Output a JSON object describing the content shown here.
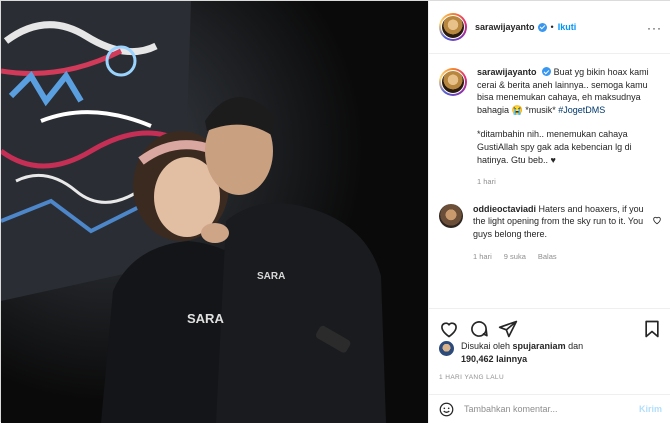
{
  "header": {
    "username": "sarawijayanto",
    "separator": "•",
    "follow_label": "Ikuti",
    "more_label": "···"
  },
  "caption": {
    "username": "sarawijayanto",
    "text_part1": "Buat yg bikin hoax kami cerai & berita aneh lainnya.. semoga kamu bisa menemukan cahaya, eh maksudnya bahagia 😭 *musik* ",
    "hashtag": "#JogetDMS",
    "text_part2": "*ditambahin nih.. menemukan cahaya GustiAllah spy gak ada kebencian lg di hatinya. Gtu beb.. ♥",
    "time": "1 hari"
  },
  "comment": {
    "username": "oddieoctaviadi",
    "text": "Haters and hoaxers, if you the light opening from the sky run to it. You guys belong there.",
    "time": "1 hari",
    "likes": "9 suka",
    "reply_label": "Balas"
  },
  "likes": {
    "line1_prefix": "Disukai oleh",
    "liker": "spujaraniam",
    "line1_suffix": "dan",
    "count": "190,462",
    "count_suffix": "lainnya"
  },
  "timestamp": "1 HARI YANG LALU",
  "add_comment": {
    "placeholder": "Tambahkan komentar...",
    "submit_label": "Kirim"
  },
  "photo": {
    "hoodie_text": "SARA"
  },
  "colors": {
    "link_blue": "#0095f6",
    "verified_blue": "#3897f0",
    "muted": "#8e8e8e",
    "submit_disabled": "#b2dffc"
  }
}
